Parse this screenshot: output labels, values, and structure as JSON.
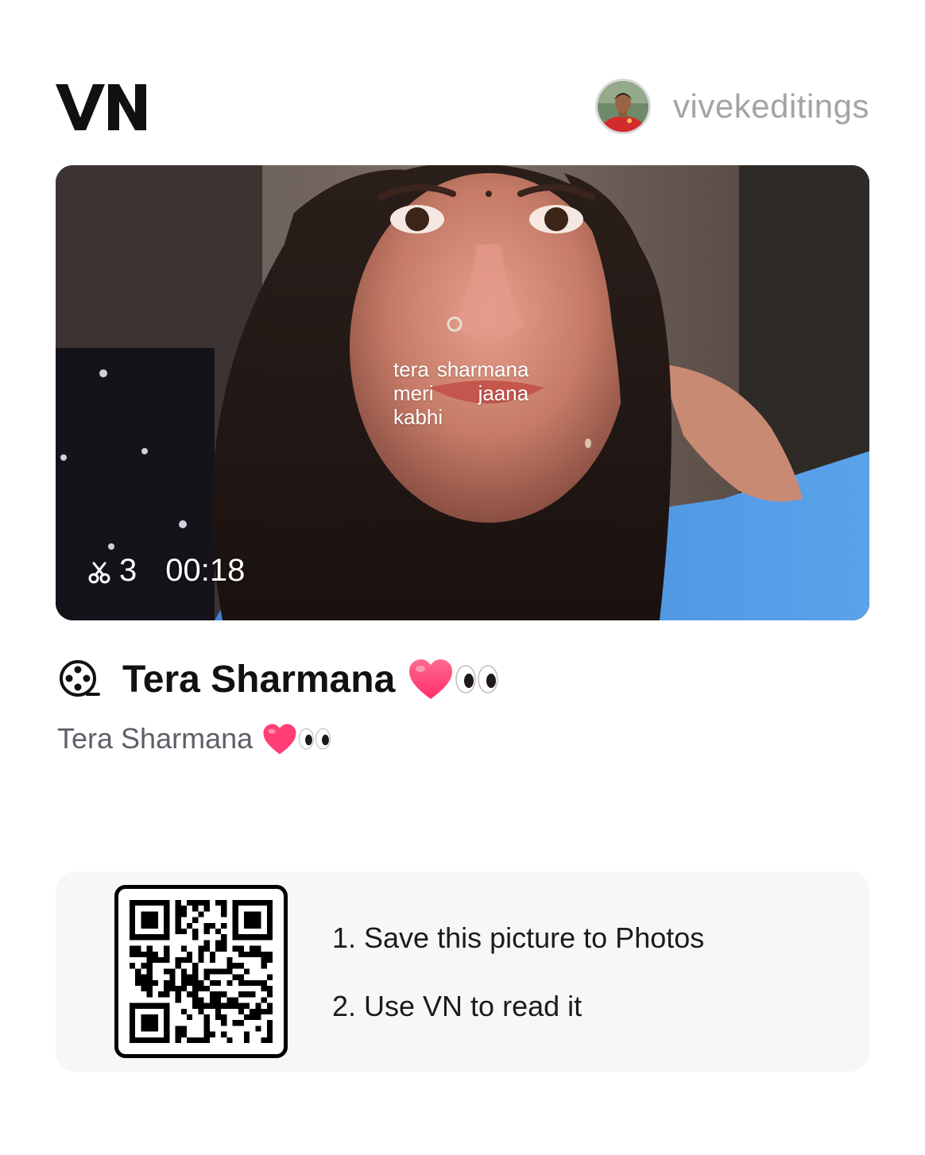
{
  "header": {
    "logo_text": "VN",
    "username": "vivekeditings"
  },
  "media": {
    "lyrics": {
      "line1_a": "tera",
      "line1_b": "sharmana",
      "line2_a": "meri",
      "line2_b": "jaana",
      "line3": "kabhi"
    },
    "clip_count": "3",
    "duration": "00:18"
  },
  "project": {
    "title": "Tera Sharmana",
    "description": "Tera Sharmana"
  },
  "qr_card": {
    "steps": [
      "1. Save this picture to Photos",
      "2. Use VN to read it"
    ]
  },
  "colors": {
    "background": "#ffffff",
    "username": "#a4a4a8",
    "subtitle": "#5e6068",
    "card_bg": "#f7f7f7"
  },
  "icons": {
    "film_reel": "film-reel-icon",
    "scissors": "scissors-icon",
    "heart": "pink-heart-emoji",
    "eyes": "eyes-emoji"
  }
}
